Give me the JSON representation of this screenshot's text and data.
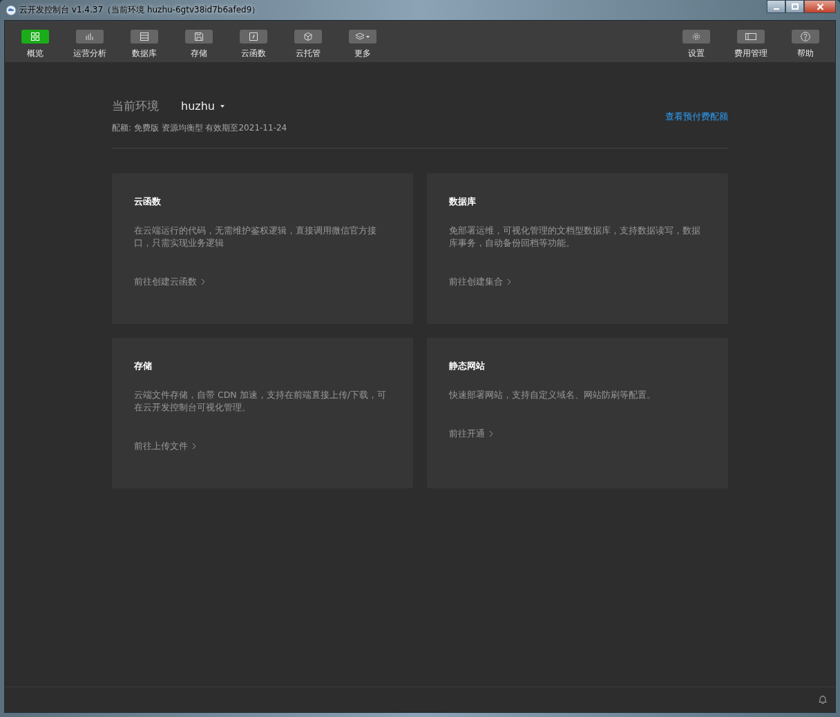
{
  "window": {
    "title": "云开发控制台 v1.4.37（当前环境 huzhu-6gtv38id7b6afed9）"
  },
  "toolbar": {
    "left": [
      {
        "label": "概览",
        "selected": true
      },
      {
        "label": "运营分析",
        "selected": false
      },
      {
        "label": "数据库",
        "selected": false
      },
      {
        "label": "存储",
        "selected": false
      },
      {
        "label": "云函数",
        "selected": false
      },
      {
        "label": "云托管",
        "selected": false
      },
      {
        "label": "更多",
        "selected": false
      }
    ],
    "right": [
      {
        "label": "设置"
      },
      {
        "label": "费用管理"
      },
      {
        "label": "帮助"
      }
    ]
  },
  "environment": {
    "label": "当前环境",
    "name": "huzhu",
    "quota": "配额: 免费版 资源均衡型 有效期至2021-11-24",
    "link": "查看预付费配额"
  },
  "cards": [
    {
      "title": "云函数",
      "description": "在云端运行的代码，无需维护鉴权逻辑，直接调用微信官方接口，只需实现业务逻辑",
      "action": "前往创建云函数"
    },
    {
      "title": "数据库",
      "description": "免部署运维，可视化管理的文档型数据库，支持数据读写，数据库事务，自动备份回档等功能。",
      "action": "前往创建集合"
    },
    {
      "title": "存储",
      "description": "云端文件存储，自带 CDN 加速，支持在前端直接上传/下载，可在云开发控制台可视化管理。",
      "action": "前往上传文件"
    },
    {
      "title": "静态网站",
      "description": "快速部署网站，支持自定义域名、网站防刷等配置。",
      "action": "前往开通"
    }
  ]
}
